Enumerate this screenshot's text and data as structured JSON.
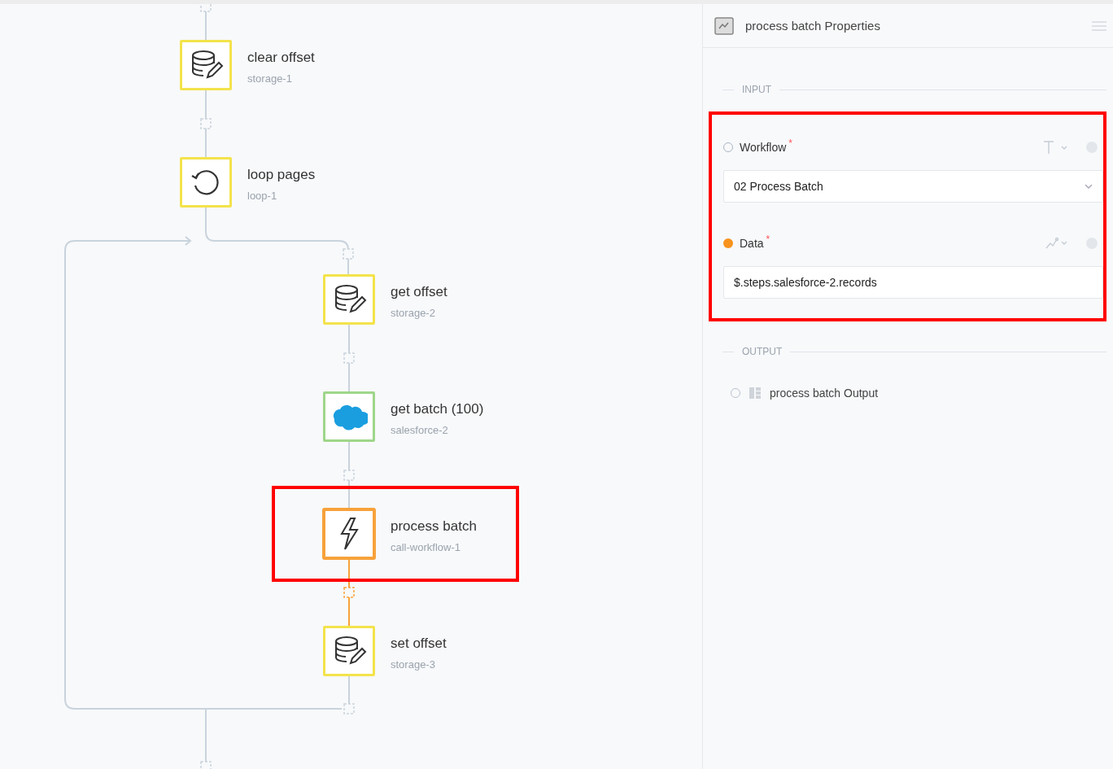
{
  "canvas": {
    "nodes": [
      {
        "name": "clear offset",
        "id": "storage-1",
        "kind": "storage",
        "color": "#f3e34b",
        "selected": false,
        "highlighted": false
      },
      {
        "name": "loop pages",
        "id": "loop-1",
        "kind": "loop",
        "color": "#f3e34b",
        "selected": false,
        "highlighted": false
      },
      {
        "name": "get offset",
        "id": "storage-2",
        "kind": "storage",
        "color": "#f3e34b",
        "selected": false,
        "highlighted": false
      },
      {
        "name": "get batch (100)",
        "id": "salesforce-2",
        "kind": "salesforce",
        "color": "#9fd68a",
        "selected": false,
        "highlighted": false
      },
      {
        "name": "process batch",
        "id": "call-workflow-1",
        "kind": "call-workflow",
        "color": "#f7a23b",
        "selected": true,
        "highlighted": true
      },
      {
        "name": "set offset",
        "id": "storage-3",
        "kind": "storage",
        "color": "#f3e34b",
        "selected": false,
        "highlighted": false
      }
    ]
  },
  "properties": {
    "title": "process batch Properties",
    "input": {
      "heading": "INPUT",
      "highlighted": true,
      "fields": [
        {
          "label": "Workflow",
          "required_mark": "*",
          "mapped": false,
          "kind": "select",
          "value": "02 Process Batch"
        },
        {
          "label": "Data",
          "required_mark": "*",
          "mapped": true,
          "kind": "text",
          "value": "$.steps.salesforce-2.records"
        }
      ]
    },
    "output": {
      "heading": "OUTPUT",
      "items": [
        {
          "label": "process batch Output",
          "selected": false
        }
      ]
    }
  }
}
